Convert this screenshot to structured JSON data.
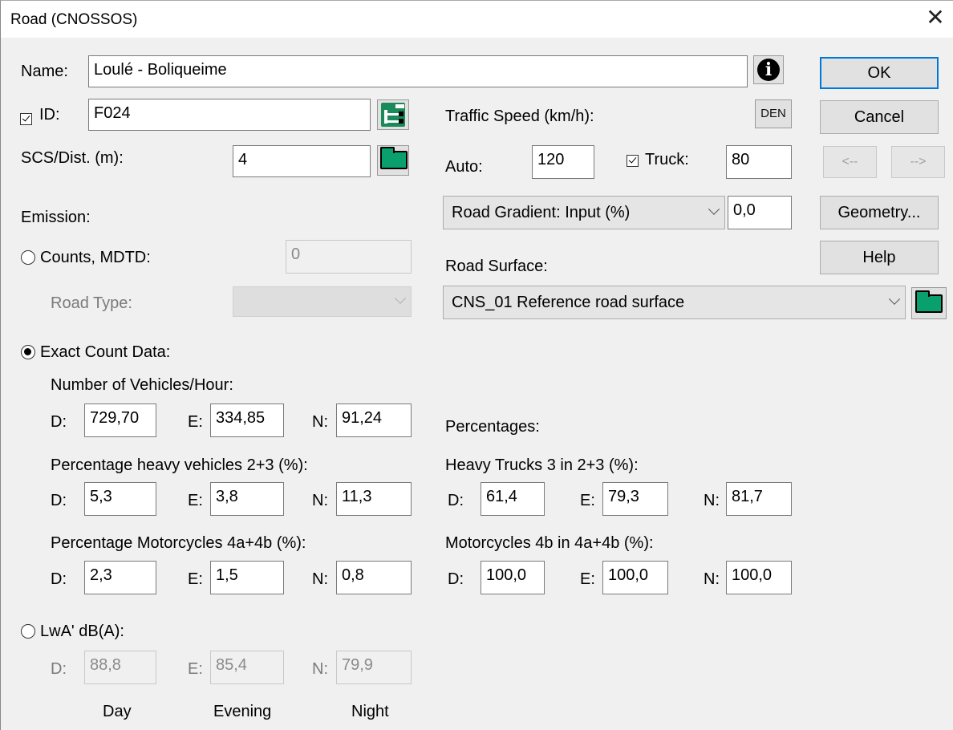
{
  "window": {
    "title": "Road (CNOSSOS)",
    "close": "✕"
  },
  "name": {
    "label": "Name:",
    "value": "Loulé - Boliqueime"
  },
  "id": {
    "label": "ID:",
    "value": "F024"
  },
  "scs": {
    "label": "SCS/Dist. (m):",
    "value": "4"
  },
  "emission_label": "Emission:",
  "counts": {
    "label": "Counts, MDTD:",
    "value": "0",
    "road_type_label": "Road Type:",
    "road_type_value": ""
  },
  "exact": {
    "label": "Exact Count Data:"
  },
  "vehicles": {
    "heading": "Number of Vehicles/Hour:",
    "d": "729,70",
    "e": "334,85",
    "n": "91,24"
  },
  "heavy": {
    "heading": "Percentage heavy vehicles 2+3 (%):",
    "d": "5,3",
    "e": "3,8",
    "n": "11,3"
  },
  "moto": {
    "heading": "Percentage Motorcycles  4a+4b (%):",
    "d": "2,3",
    "e": "1,5",
    "n": "0,8"
  },
  "lwa": {
    "label": "LwA' dB(A):",
    "d": "88,8",
    "e": "85,4",
    "n": "79,9"
  },
  "period_labels": {
    "d": "D:",
    "e": "E:",
    "n": "N:"
  },
  "footer": {
    "day": "Day",
    "evening": "Evening",
    "night": "Night"
  },
  "traffic": {
    "heading": "Traffic Speed (km/h):",
    "den_label": "DEN",
    "auto_label": "Auto:",
    "auto_value": "120",
    "truck_label": "Truck:",
    "truck_value": "80"
  },
  "gradient": {
    "selected": "Road Gradient: Input (%)",
    "value": "0,0"
  },
  "surface": {
    "label": "Road Surface:",
    "selected": "CNS_01 Reference road surface"
  },
  "percentages_label": "Percentages:",
  "trucks3": {
    "heading": "Heavy Trucks 3 in 2+3 (%):",
    "d": "61,4",
    "e": "79,3",
    "n": "81,7"
  },
  "moto4b": {
    "heading": "Motorcycles 4b in 4a+4b (%):",
    "d": "100,0",
    "e": "100,0",
    "n": "100,0"
  },
  "buttons": {
    "ok": "OK",
    "cancel": "Cancel",
    "prev": "<--",
    "next": "-->",
    "geometry": "Geometry...",
    "help": "Help"
  },
  "icons": {
    "info": "info-icon",
    "tree": "tree-icon",
    "folder": "folder-icon"
  },
  "colors": {
    "accent": "#0078d7",
    "folder": "#0aa06e"
  }
}
